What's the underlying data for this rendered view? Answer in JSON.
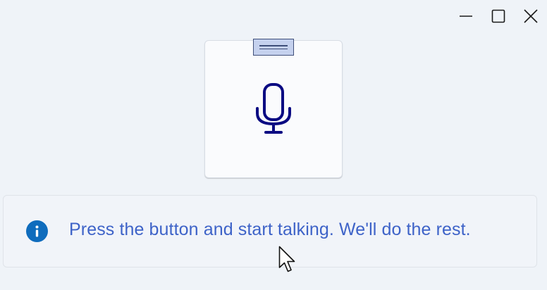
{
  "window_controls": {
    "minimize_icon": "minimize-icon",
    "maximize_icon": "maximize-icon",
    "close_icon": "close-icon"
  },
  "mic_card": {
    "icon": "microphone-icon",
    "icon_color": "#0a0a82",
    "handle_icon": "drag-handle-icon"
  },
  "info_bar": {
    "icon": "info-icon",
    "icon_color": "#0f6cbd",
    "message": "Press the button and start talking. We'll do the rest.",
    "text_color": "#3e63c8"
  },
  "colors": {
    "background": "#eff3f8",
    "card": "#fafbfd"
  }
}
